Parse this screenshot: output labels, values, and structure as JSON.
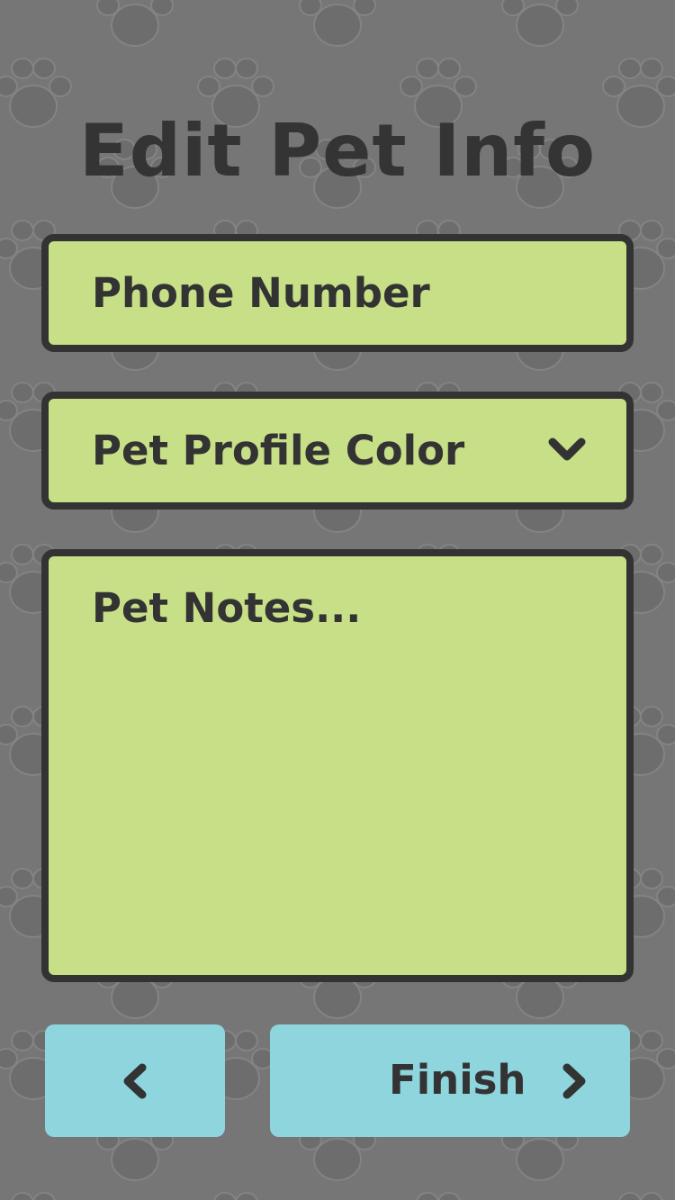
{
  "page": {
    "title": "Edit Pet Info",
    "background_color": "#767676",
    "background_pattern": "paw-print-pattern"
  },
  "form": {
    "phone": {
      "placeholder": "Phone Number",
      "value": ""
    },
    "profile_color": {
      "placeholder": "Pet Profile Color",
      "icon": "chevron-down-icon"
    },
    "notes": {
      "placeholder": "Pet Notes...",
      "value": ""
    }
  },
  "footer": {
    "back_icon": "chevron-left-icon",
    "finish_label": "Finish",
    "finish_icon": "chevron-right-icon"
  },
  "colors": {
    "field_fill": "#c7df86",
    "field_border": "#333333",
    "button_fill": "#8ed5de",
    "text": "#333333"
  }
}
